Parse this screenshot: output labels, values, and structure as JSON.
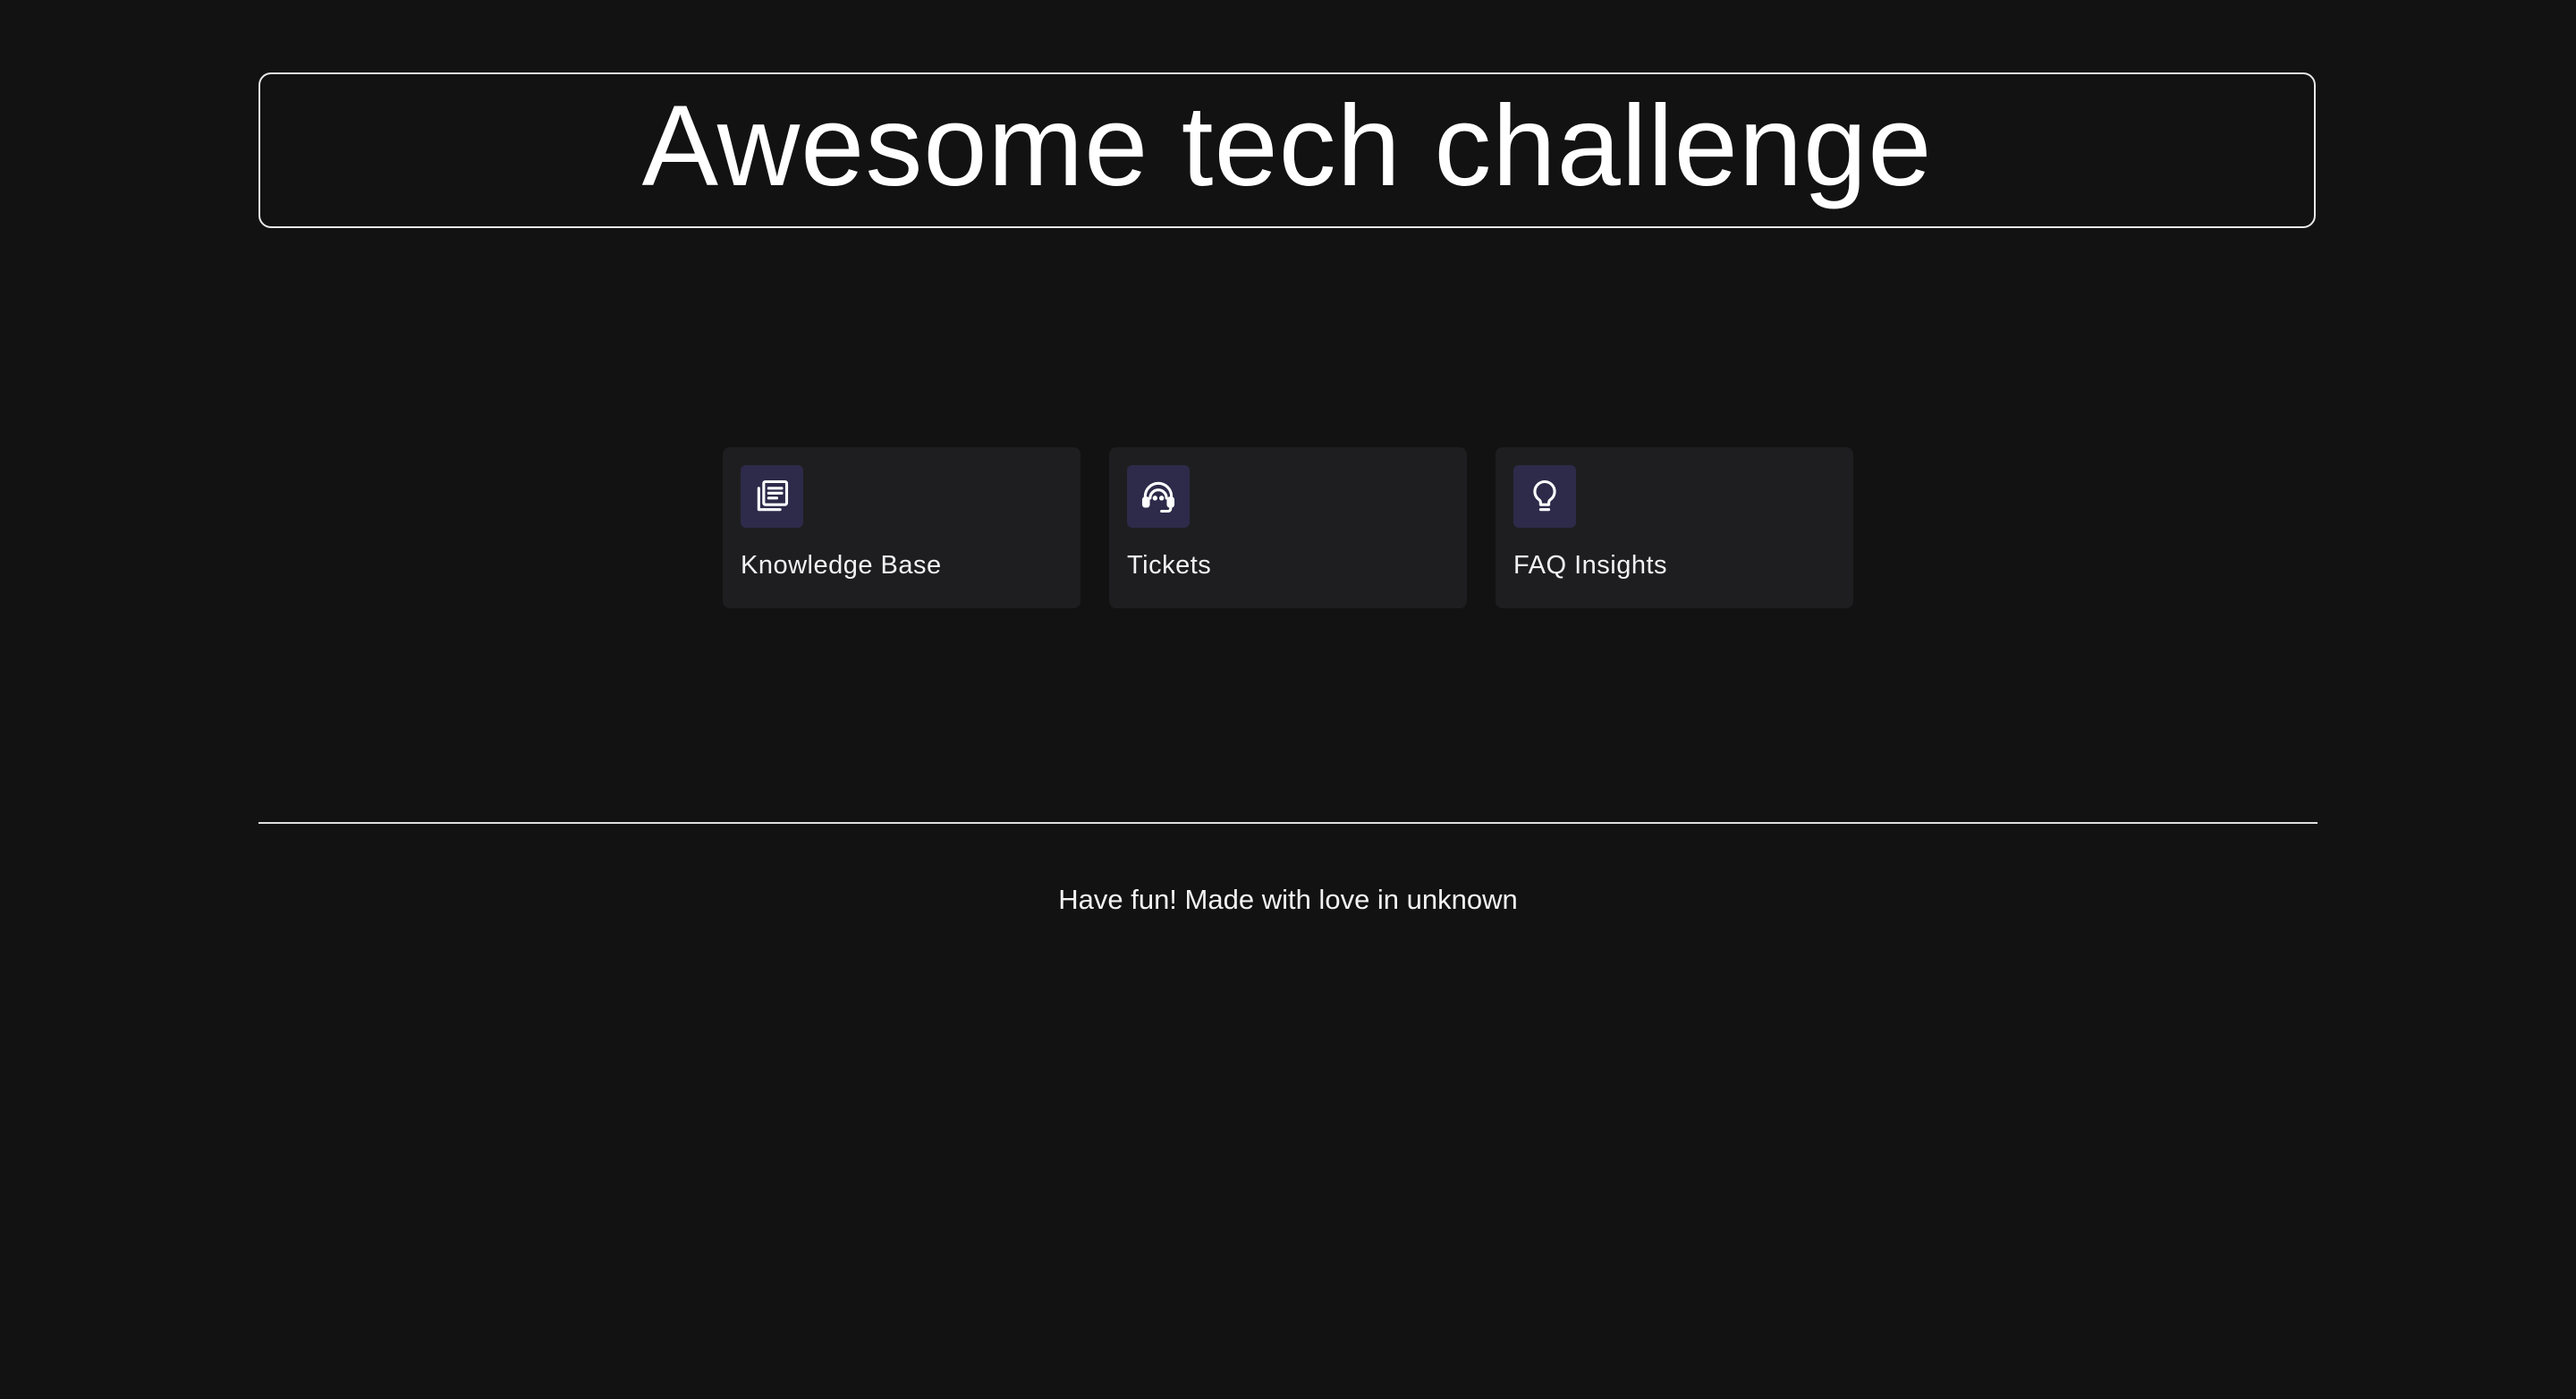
{
  "header": {
    "title": "Awesome tech challenge"
  },
  "cards": [
    {
      "label": "Knowledge Base",
      "icon": "newspaper-icon"
    },
    {
      "label": "Tickets",
      "icon": "headset-support-icon"
    },
    {
      "label": "FAQ Insights",
      "icon": "lightbulb-icon"
    }
  ],
  "footer": {
    "text": "Have fun! Made with love in unknown"
  },
  "colors": {
    "background": "#121212",
    "card_background": "#1e1e20",
    "icon_tile": "#2d2a4a",
    "text": "#ffffff",
    "border": "#e8e8e8"
  }
}
